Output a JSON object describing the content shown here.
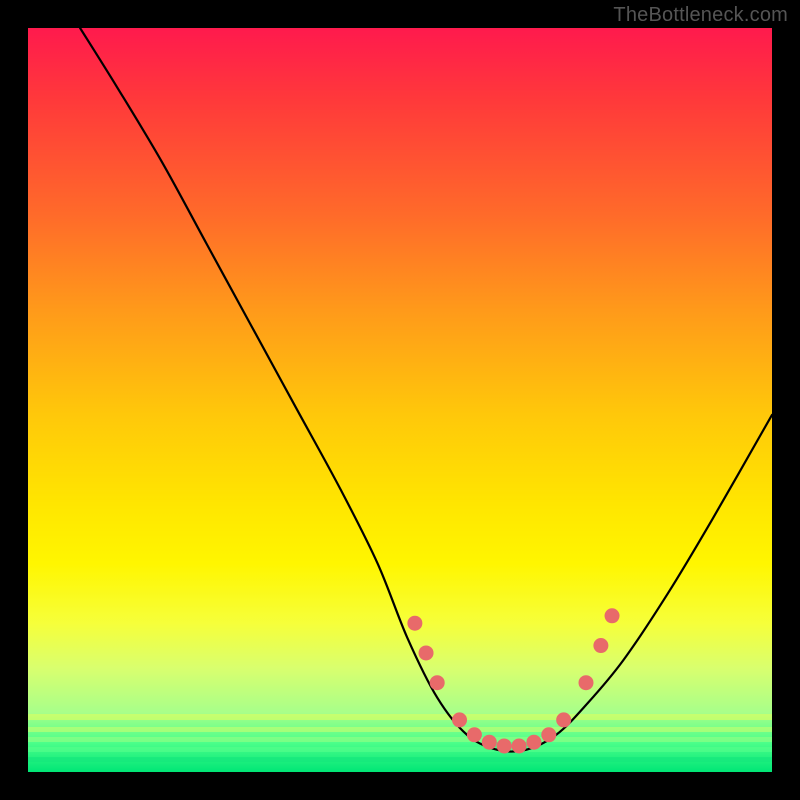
{
  "watermark": "TheBottleneck.com",
  "chart_data": {
    "type": "line",
    "title": "",
    "xlabel": "",
    "ylabel": "",
    "xlim": [
      0,
      100
    ],
    "ylim": [
      0,
      100
    ],
    "series": [
      {
        "name": "bottleneck-curve",
        "x": [
          7,
          12,
          18,
          24,
          30,
          36,
          42,
          47,
          51,
          55,
          59,
          63,
          67,
          71,
          75,
          80,
          86,
          92,
          100
        ],
        "y": [
          100,
          92,
          82,
          71,
          60,
          49,
          38,
          28,
          18,
          10,
          5,
          3,
          3,
          5,
          9,
          15,
          24,
          34,
          48
        ]
      }
    ],
    "markers": {
      "name": "highlight-points",
      "color": "#e86a6a",
      "x": [
        52,
        53.5,
        55,
        58,
        60,
        62,
        64,
        66,
        68,
        70,
        72,
        75,
        77,
        78.5
      ],
      "y": [
        20,
        16,
        12,
        7,
        5,
        4,
        3.5,
        3.5,
        4,
        5,
        7,
        12,
        17,
        21
      ]
    },
    "gradient_stops": [
      {
        "pos": 0,
        "color": "#ff1a4d"
      },
      {
        "pos": 25,
        "color": "#ff6a2a"
      },
      {
        "pos": 52,
        "color": "#ffc80a"
      },
      {
        "pos": 72,
        "color": "#fff600"
      },
      {
        "pos": 100,
        "color": "#00e676"
      }
    ]
  }
}
